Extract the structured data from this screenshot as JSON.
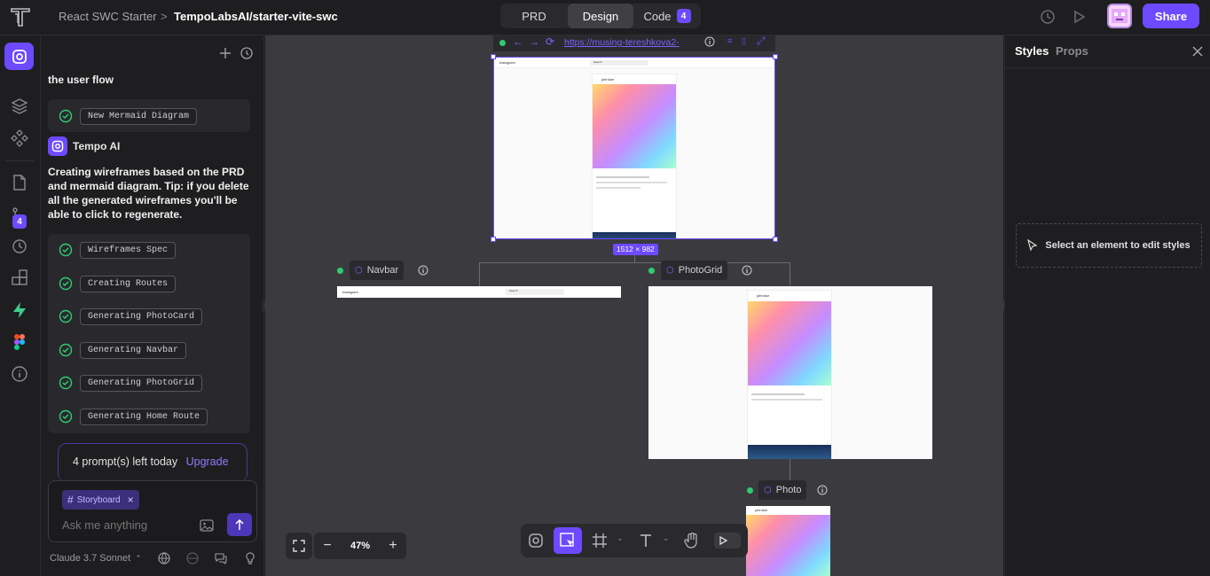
{
  "topbar": {
    "project_name": "React SWC Starter",
    "separator": ">",
    "repo": "TempoLabsAI/starter-vite-swc",
    "tabs": [
      {
        "label": "PRD"
      },
      {
        "label": "Design"
      },
      {
        "label": "Code",
        "badge": "4"
      }
    ],
    "share_label": "Share"
  },
  "left_rail": {
    "badge": "4",
    "icons": [
      "tempo-icon",
      "layers-icon",
      "components-icon",
      "page-icon",
      "git-branch-icon",
      "history-icon",
      "blocks-icon",
      "supabase-icon",
      "figma-icon",
      "info-icon"
    ]
  },
  "chat": {
    "partial_heading": "the user flow",
    "step1": "New Mermaid Diagram",
    "ai_name": "Tempo AI",
    "ai_message": "Creating wireframes based on the PRD and mermaid diagram. Tip: if you delete all the generated wireframes you'll be able to click to regenerate.",
    "steps": [
      "Wireframes Spec",
      "Creating Routes",
      "Generating PhotoCard",
      "Generating Navbar",
      "Generating PhotoGrid",
      "Generating Home Route"
    ],
    "prompts_left": "4 prompt(s) left today",
    "upgrade": "Upgrade",
    "storyboard_chip": "Storyboard",
    "input_placeholder": "Ask me anything",
    "model": "Claude 3.7 Sonnet"
  },
  "canvas": {
    "url": "https://musing-tereshkova2-",
    "frame_size": "1512 × 982",
    "frames": [
      {
        "label": "Navbar"
      },
      {
        "label": "PhotoGrid"
      },
      {
        "label": "Photo"
      }
    ],
    "zoom": "47%",
    "mini_username": "johndoe",
    "mini_search": "Search",
    "mini_app": "Instagram"
  },
  "right_panel": {
    "tabs": [
      "Styles",
      "Props"
    ],
    "empty_message": "Select an element to edit styles"
  },
  "colors": {
    "accent": "#6d4aff",
    "status": "#2ecc71"
  }
}
